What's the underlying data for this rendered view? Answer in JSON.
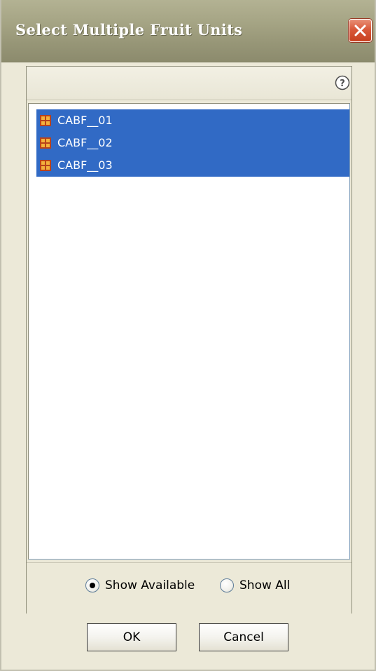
{
  "window": {
    "title": "Select Multiple Fruit Units"
  },
  "panel": {
    "help_icon": "help-icon",
    "items": [
      {
        "label": "CABF__01",
        "icon": "fruit-unit-icon",
        "selected": true
      },
      {
        "label": "CABF__02",
        "icon": "fruit-unit-icon",
        "selected": true
      },
      {
        "label": "CABF__03",
        "icon": "fruit-unit-icon",
        "selected": true
      }
    ],
    "filter": {
      "show_available_label": "Show Available",
      "show_all_label": "Show All",
      "selected": "show_available"
    }
  },
  "buttons": {
    "ok_label": "OK",
    "cancel_label": "Cancel"
  },
  "colors": {
    "selection": "#316ac5",
    "titlebar": "#a6a585",
    "close_button": "#d9593a",
    "window_bg": "#ece9d8"
  }
}
